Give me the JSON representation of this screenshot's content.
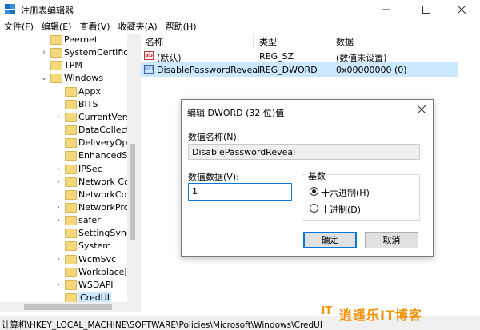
{
  "window": {
    "title": "注册表编辑器"
  },
  "menu": [
    "文件(F)",
    "编辑(E)",
    "查看(V)",
    "收藏夹(A)",
    "帮助(H)"
  ],
  "tree": {
    "items": [
      {
        "label": "Peernet",
        "arrow": "",
        "selected": false
      },
      {
        "label": "SystemCertificate",
        "arrow": ">",
        "selected": false
      },
      {
        "label": "TPM",
        "arrow": "",
        "selected": false
      },
      {
        "label": "Windows",
        "arrow": "v",
        "selected": false
      },
      {
        "label": "Appx",
        "arrow": "",
        "selected": false
      },
      {
        "label": "BITS",
        "arrow": "",
        "selected": false
      },
      {
        "label": "CurrentVersic",
        "arrow": ">",
        "selected": false
      },
      {
        "label": "DataCollectio",
        "arrow": "",
        "selected": false
      },
      {
        "label": "DeliveryOptin",
        "arrow": "",
        "selected": false
      },
      {
        "label": "EnhancedStoi",
        "arrow": "",
        "selected": false
      },
      {
        "label": "IPSec",
        "arrow": ">",
        "selected": false
      },
      {
        "label": "Network Con",
        "arrow": ">",
        "selected": false
      },
      {
        "label": "NetworkConn",
        "arrow": "",
        "selected": false
      },
      {
        "label": "NetworkProv",
        "arrow": ">",
        "selected": false
      },
      {
        "label": "safer",
        "arrow": ">",
        "selected": false
      },
      {
        "label": "SettingSync",
        "arrow": "",
        "selected": false
      },
      {
        "label": "System",
        "arrow": "",
        "selected": false
      },
      {
        "label": "WcmSvc",
        "arrow": ">",
        "selected": false
      },
      {
        "label": "WorkplaceJo",
        "arrow": "",
        "selected": false
      },
      {
        "label": "WSDAPI",
        "arrow": ">",
        "selected": false
      },
      {
        "label": "CredUI",
        "arrow": "",
        "selected": true
      }
    ]
  },
  "list": {
    "headers": {
      "name": "名称",
      "type": "类型",
      "data": "数据"
    },
    "rows": [
      {
        "icon": "string-value-icon",
        "icon_text": "ab",
        "name": "(默认)",
        "type": "REG_SZ",
        "data": "(数值未设置)",
        "selected": false
      },
      {
        "icon": "binary-value-icon",
        "icon_text": "011",
        "name": "DisablePasswordReveal",
        "type": "REG_DWORD",
        "data": "0x00000000 (0)",
        "selected": true
      }
    ]
  },
  "status": {
    "path": "计算机\\HKEY_LOCAL_MACHINE\\SOFTWARE\\Policies\\Microsoft\\Windows\\CredUI"
  },
  "dialog": {
    "title": "编辑 DWORD (32 位)值",
    "name_label": "数值名称(N):",
    "name_value": "DisablePasswordReveal",
    "data_label": "数值数据(V):",
    "data_value": "1",
    "base_label": "基数",
    "radio_hex": "十六进制(H)",
    "radio_dec": "十进制(D)",
    "selected_base": "hex",
    "ok_label": "确定",
    "cancel_label": "取消"
  },
  "watermark": {
    "it": "IT",
    "text": "逍遥乐IT博客"
  },
  "colors": {
    "selection": "#cce8ff",
    "accent": "#0078d7",
    "folder": "#f5d77c",
    "watermark": "#f39100"
  }
}
